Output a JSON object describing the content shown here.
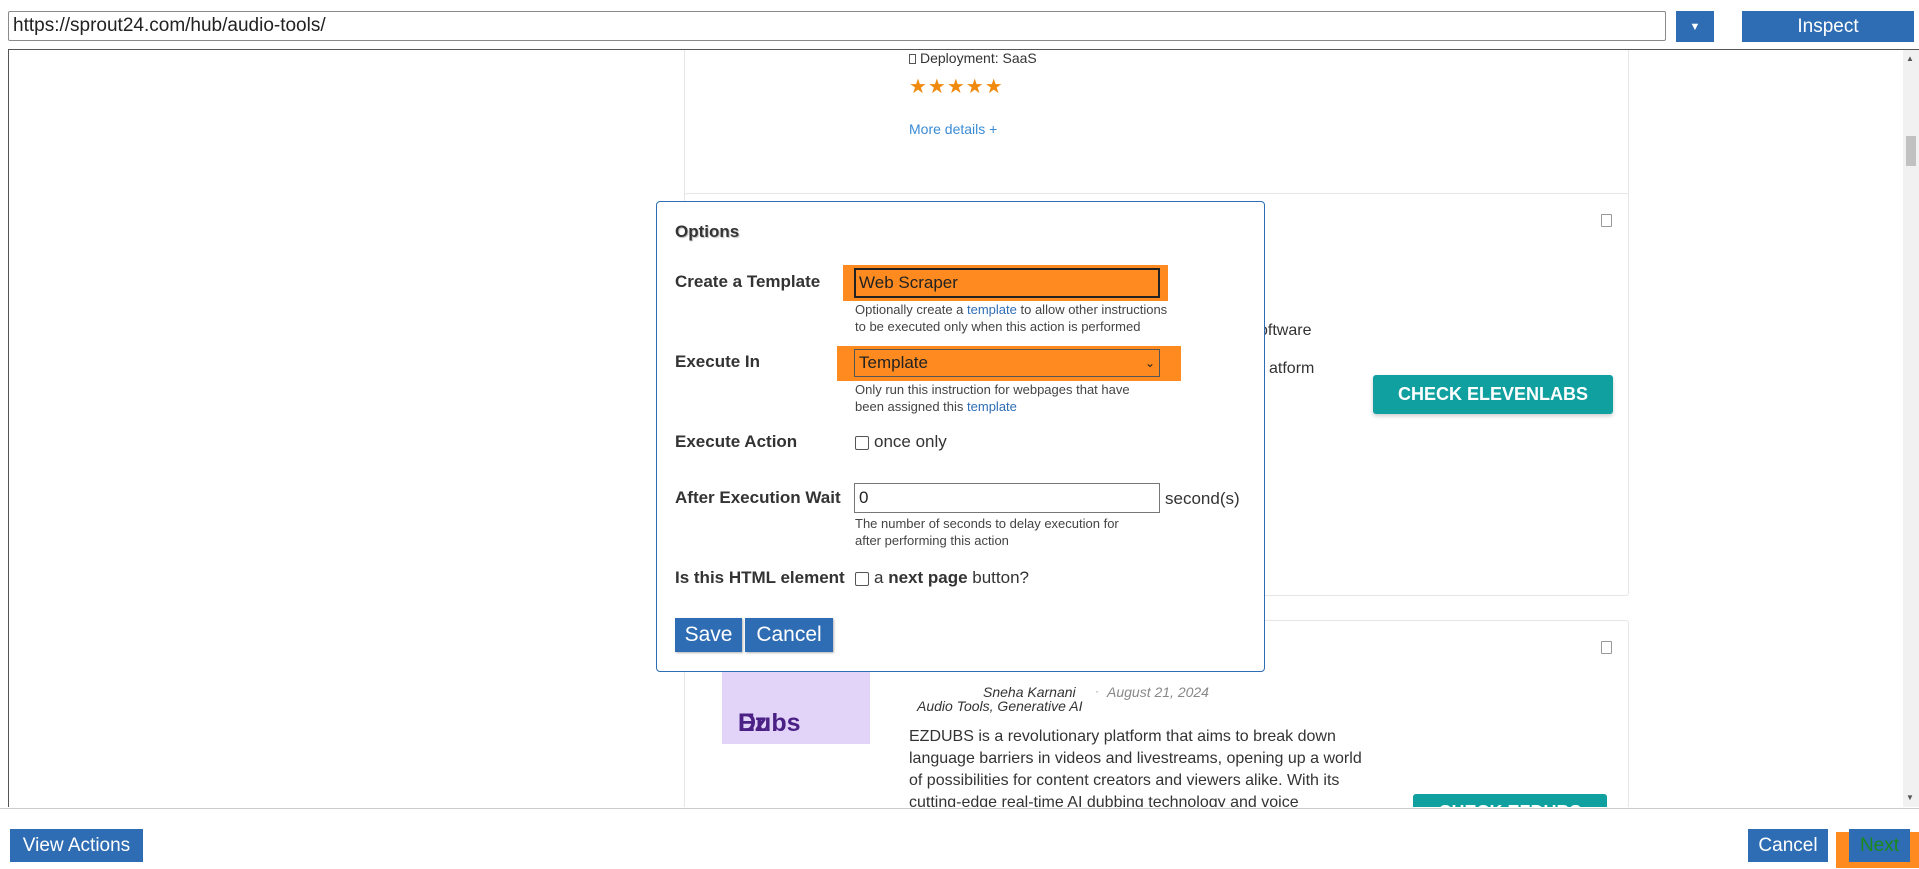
{
  "toolbar": {
    "url": "https://sprout24.com/hub/audio-tools/",
    "dropdown_glyph": "▼",
    "inspect_label": "Inspect"
  },
  "page": {
    "card1": {
      "deployment": "Deployment: SaaS",
      "stars": "★★★★★",
      "more_details": "More details +"
    },
    "card2": {
      "snippet_line1": "oftware",
      "snippet_line2": "atform",
      "check_button": "CHECK ELEVENLABS"
    },
    "card3": {
      "author": "Sneha Karnani",
      "separator": "·",
      "date": "August 21, 2024",
      "categories": "Audio Tools, Generative AI",
      "logo_text_line1": "Ez",
      "logo_text_line2": "Dubs",
      "description": "EZDUBS is a revolutionary platform that aims to break down language barriers in videos and livestreams, opening up a world of possibilities for content creators and viewers alike. With its cutting-edge real-time AI dubbing technology and voice",
      "check_button": "CHECK EZDUBS"
    }
  },
  "modal": {
    "title": "Options",
    "template": {
      "label": "Create a Template",
      "value": "Web Scraper",
      "hint_before": "Optionally create a ",
      "hint_link": "template",
      "hint_after": " to allow other instructions to be executed only when this action is performed"
    },
    "execute_in": {
      "label": "Execute In",
      "value": "Template",
      "hint_before": "Only run this instruction for webpages that have been assigned this ",
      "hint_link": "template"
    },
    "execute_action": {
      "label": "Execute Action",
      "checkbox_label": "once only",
      "checked": false
    },
    "wait": {
      "label": "After Execution Wait",
      "value": "0",
      "unit": "second(s)",
      "hint": "The number of seconds to delay execution for after performing this action"
    },
    "next_page": {
      "label": "Is this HTML element",
      "checkbox_prefix": "a ",
      "checkbox_bold": "next page",
      "checkbox_suffix": " button?",
      "checked": false
    },
    "save_label": "Save",
    "cancel_label": "Cancel"
  },
  "bottom": {
    "view_actions_label": "View Actions",
    "cancel_label": "Cancel",
    "next_label": "Next"
  },
  "colors": {
    "primary": "#2e6db4",
    "highlight": "#ff8a1f",
    "teal": "#11a0a0",
    "star": "#f08a0f"
  }
}
